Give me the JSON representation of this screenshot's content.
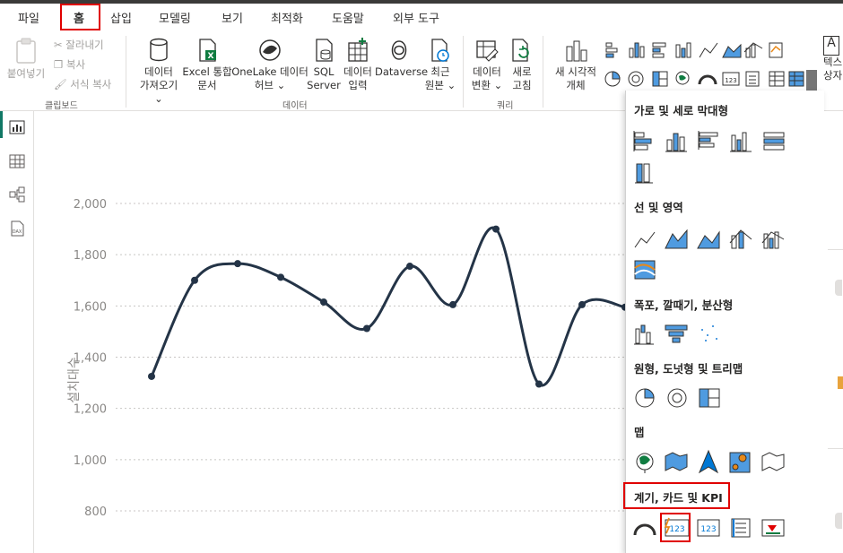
{
  "tabs": [
    "파일",
    "홈",
    "삽입",
    "모델링",
    "보기",
    "최적화",
    "도움말",
    "외부 도구"
  ],
  "active_tab": "홈",
  "ribbon": {
    "clipboard": {
      "paste": "붙여넣기",
      "cut": "잘라내기",
      "copy": "복사",
      "format_painter": "서식 복사",
      "group": "클립보드"
    },
    "data": {
      "get_data_line1": "데이터",
      "get_data_line2": "가져오기",
      "excel_line1": "Excel 통합",
      "excel_line2": "문서",
      "onelake_line1": "OneLake 데이터",
      "onelake_line2": "허브",
      "sql_line1": "SQL",
      "sql_line2": "Server",
      "enter_line1": "데이터",
      "enter_line2": "입력",
      "dataverse": "Dataverse",
      "recent_line1": "최근",
      "recent_line2": "원본",
      "group": "데이터"
    },
    "query": {
      "transform_line1": "데이터",
      "transform_line2": "변환",
      "refresh_line1": "새로",
      "refresh_line2": "고침",
      "group": "쿼리"
    },
    "new_visual_line1": "새 시각적",
    "new_visual_line2": "개체",
    "right_partial_1": "텍스",
    "right_partial_2": "상자"
  },
  "panel": {
    "sections": [
      "가로 및 세로 막대형",
      "선 및 영역",
      "폭포, 깔때기, 분산형",
      "원형, 도넛형 및 트리맵",
      "맵",
      "계기, 카드 및 KPI"
    ],
    "card_label": "123",
    "multirow_label": "123"
  },
  "chart_data": {
    "type": "line",
    "ylabel": "설치대수",
    "yticks": [
      "2,000",
      "1,800",
      "1,600",
      "1,400",
      "1,200",
      "1,000",
      "800"
    ],
    "ylim": [
      800,
      2000
    ],
    "values": [
      1325,
      1700,
      1765,
      1712,
      1615,
      1512,
      1755,
      1605,
      1900,
      1295,
      1605,
      1595
    ],
    "line_color": "#243447",
    "grid": true
  },
  "colors": {
    "accent": "#117865",
    "highlight_red": "#e00000"
  }
}
